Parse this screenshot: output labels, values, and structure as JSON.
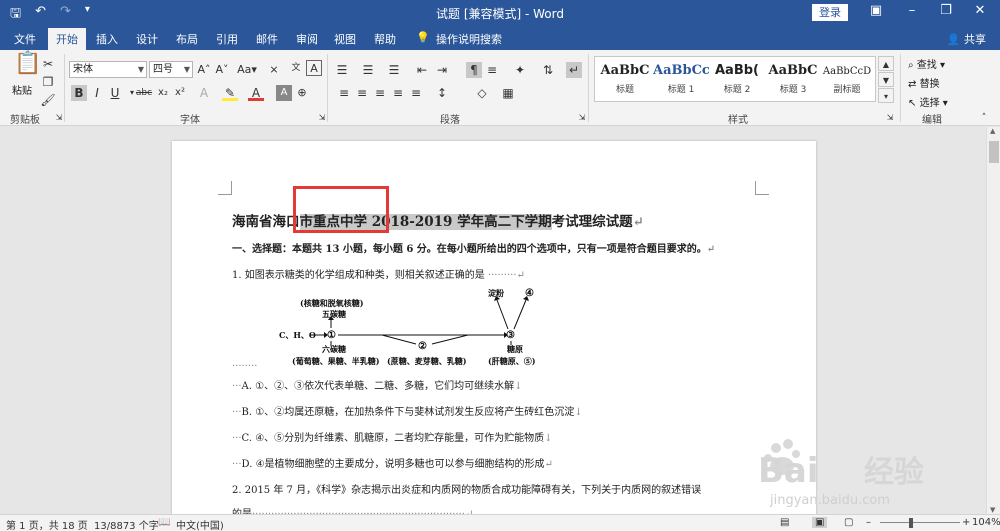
{
  "titlebar": {
    "doc_title": "试题 [兼容模式] - Word",
    "login": "登录",
    "save_icon": "save-icon",
    "undo_icon": "undo-icon"
  },
  "tabs": [
    "文件",
    "开始",
    "插入",
    "设计",
    "布局",
    "引用",
    "邮件",
    "审阅",
    "视图",
    "帮助"
  ],
  "tell_me": "操作说明搜索",
  "share": "共享",
  "ribbon": {
    "clipboard": {
      "paste": "粘贴",
      "label": "剪贴板"
    },
    "font": {
      "name": "宋体",
      "size": "四号",
      "label": "字体"
    },
    "paragraph": {
      "label": "段落"
    },
    "styles": {
      "label": "样式",
      "items": [
        {
          "preview": "AaBbC",
          "name": "标题"
        },
        {
          "preview": "AaBbCc",
          "name": "标题 1"
        },
        {
          "preview": "AaBb(",
          "name": "标题 2"
        },
        {
          "preview": "AaBbC",
          "name": "标题 3"
        },
        {
          "preview": "AaBbCcD",
          "name": "副标题"
        }
      ]
    },
    "editing": {
      "find": "查找",
      "replace": "替换",
      "select": "选择",
      "label": "编辑"
    }
  },
  "document": {
    "title_prefix": "海南省海口",
    "title_selected": "市重点中学 2018-2019 学年高二下学期",
    "title_suffix": "考试理综试题",
    "section": "一、选择题：本题共 13 小题，每小题 6 分。在每小题所给出的四个选项中，只有一项是符合题目要求的。",
    "q1": "1. 如图表示糖类的化学组成和种类，则相关叙述正确的是",
    "diagram": {
      "chnode": "C、H、O",
      "top_left": "(核糖和脱氧核糖)",
      "wutang": "五碳糖",
      "liutang": "六碳糖",
      "bottom_left": "(葡萄糖、果糖、半乳糖)",
      "bottom_mid": "(蔗糖、麦芽糖、乳糖)",
      "dianfen": "淀粉",
      "tangyuan": "糖原",
      "bottom_right": "(肝糖原、⑤)",
      "n1": "①",
      "n2": "②",
      "n3": "③",
      "n4": "④"
    },
    "optA": "A. ①、②、③依次代表单糖、二糖、多糖，它们均可继续水解",
    "optB": "B. ①、②均属还原糖，在加热条件下与斐林试剂发生反应将产生砖红色沉淀",
    "optC": "C. ④、⑤分别为纤维素、肌糖原，二者均贮存能量，可作为贮能物质",
    "optD": "D. ④是植物细胞壁的主要成分，说明多糖也可以参与细胞结构的形成",
    "q2": "2. 2015 年 7 月，《科学》杂志揭示出炎症和内质网的物质合成功能障碍有关，下列关于内质网的叙述错误",
    "q2b": "的是"
  },
  "statusbar": {
    "page": "第 1 页，共 18 页",
    "words": "13/8873 个字",
    "lang": "中文(中国)",
    "zoom": "104%"
  },
  "watermark": {
    "brand": "Bai",
    "brand2": "经验",
    "url": "jingyan.baidu.com"
  },
  "colors": {
    "accent": "#2b579a",
    "highlight_box": "#e53935"
  }
}
